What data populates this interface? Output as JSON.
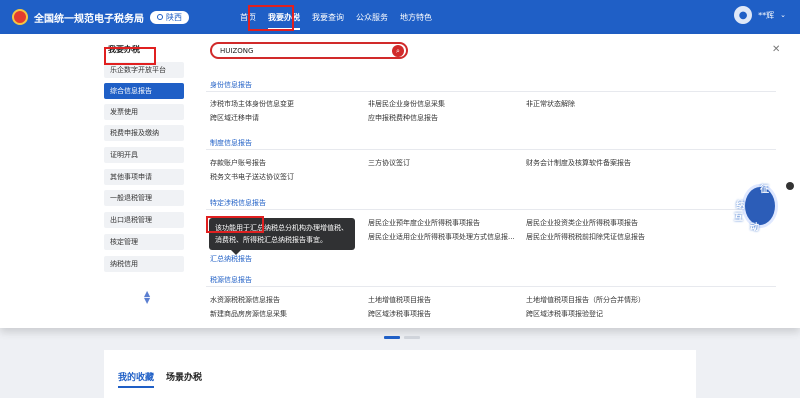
{
  "header": {
    "site_title": "全国统一规范电子税务局",
    "region": "陕西",
    "nav": [
      "首页",
      "我要办税",
      "我要查询",
      "公众服务",
      "地方特色"
    ],
    "user_name": "**辉",
    "user_caret": "⌄"
  },
  "sidebar": {
    "title": "我要办税",
    "items": [
      "乐企数字开放平台",
      "综合信息报告",
      "发票使用",
      "税费申报及缴纳",
      "证明开具",
      "其他事项申请",
      "一般退税管理",
      "出口退税管理",
      "核定管理",
      "纳税信用"
    ]
  },
  "search": {
    "value": "HUIZONG",
    "button_icon": "search-icon"
  },
  "close_icon": "✕",
  "sections": [
    {
      "title": "身份信息报告",
      "links": [
        "涉税市场主体身份信息变更",
        "非居民企业身份信息采集",
        "非正常状态解除",
        "跨区域迁移申请",
        "应申报税费种信息报告"
      ]
    },
    {
      "title": "制度信息报告",
      "links": [
        "存款账户账号报告",
        "三方协议签订",
        "财务会计制度及核算软件备案报告",
        "税务文书电子送达协议签订"
      ]
    },
    {
      "title": "特定涉税信息报告",
      "links": [
        "居民企业预年度企业所得税事项报告",
        "居民企业投资类企业所得税事项报告",
        "居民企业适用企业所得税事项处理方式信息报...",
        "居民企业所得税税前扣除凭证信息报告",
        "汇总纳税报告"
      ]
    },
    {
      "title": "税源信息报告",
      "links": [
        "水资源税税源信息报告",
        "土地增值税项目报告",
        "土地增值税项目报告（所分合并情形）",
        "新建商品房房源信息采集",
        "跨区域涉税事项报告",
        "跨区域涉税事项报验登记"
      ]
    }
  ],
  "tooltip": {
    "line1": "该功能用于汇总纳税总分机构办理增值税、",
    "line2": "消费税、所得税汇总纳税报告事宜。"
  },
  "bottom_tabs": [
    "我的收藏",
    "场景办税"
  ],
  "assistant": {
    "chars": [
      "征",
      "纳",
      "互",
      "动"
    ]
  },
  "colors": {
    "brand": "#1f5fc6",
    "highlight": "#e02020",
    "search_border": "#d12a2a"
  }
}
